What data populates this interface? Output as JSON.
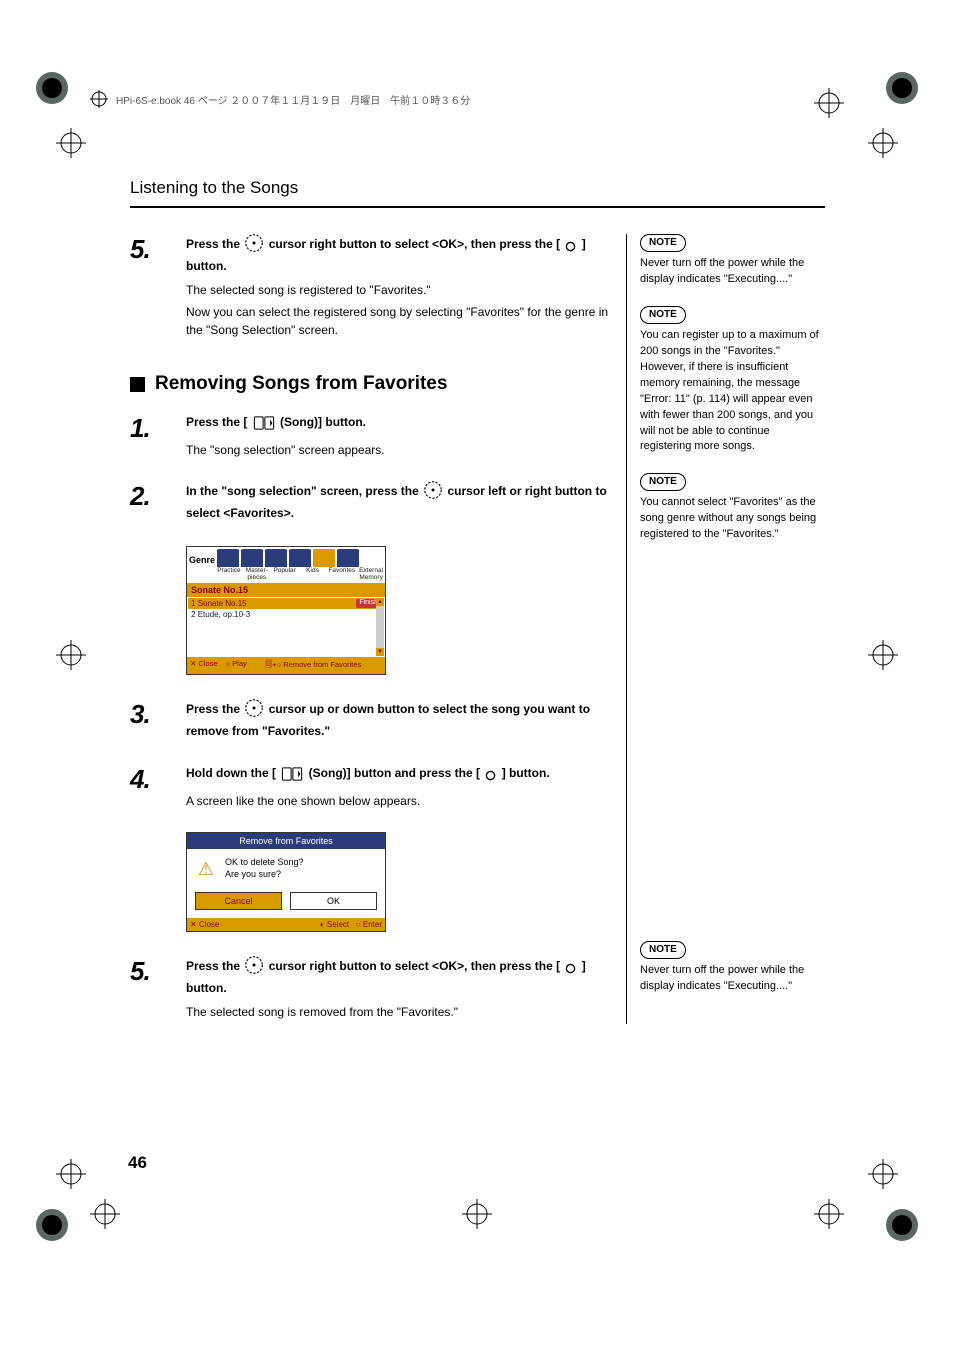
{
  "book_header": "HPi-6S-e.book  46 ページ  ２００７年１１月１９日　月曜日　午前１０時３６分",
  "page_title": "Listening to the Songs",
  "page_number": "46",
  "section1": {
    "step5": {
      "num": "5.",
      "head_a": "Press the ",
      "head_b": " cursor right button to select <OK>, then press the [",
      "head_c": "] button.",
      "desc1": "The selected song is registered to \"Favorites.\"",
      "desc2": "Now you can select the registered song by selecting \"Favorites\" for the genre in the \"Song Selection\" screen."
    }
  },
  "section2": {
    "heading": "Removing Songs from Favorites",
    "step1": {
      "num": "1.",
      "head_a": "Press the [",
      "head_b": " (Song)] button.",
      "desc1": "The \"song selection\" screen appears."
    },
    "step2": {
      "num": "2.",
      "head_a": "In the \"song selection\" screen, press the ",
      "head_b": " cursor left or right button to select <Favorites>."
    },
    "step3": {
      "num": "3.",
      "head_a": "Press the ",
      "head_b": " cursor up or down button to select the song you want to remove from \"Favorites.\""
    },
    "step4": {
      "num": "4.",
      "head_a": "Hold down the [",
      "head_b": " (Song)] button and press the [",
      "head_c": "] button.",
      "desc1": "A screen like the one shown below appears."
    },
    "step5": {
      "num": "5.",
      "head_a": "Press the ",
      "head_b": " cursor right button to select <OK>, then press the [",
      "head_c": "] button.",
      "desc1": "The selected song is removed from the \"Favorites.\""
    }
  },
  "screenshot1": {
    "genre_label": "Genre",
    "tabs": [
      "Practice",
      "Master-pieces",
      "Popular",
      "Kids",
      "Favorites",
      "External Memory"
    ],
    "title": "Sonate No.15",
    "rows": [
      {
        "idx": "1",
        "name": "Sonate No.15",
        "badge": "Finish"
      },
      {
        "idx": "2",
        "name": "Etude, op.10-3",
        "badge": ""
      }
    ],
    "footer": {
      "close": "✕ Close",
      "play": "○ Play",
      "remove": "🗐+○ Remove from Favorites"
    }
  },
  "dialog1": {
    "title": "Remove from Favorites",
    "msg1": "OK to delete Song?",
    "msg2": "Are you sure?",
    "cancel": "Cancel",
    "ok": "OK",
    "footer": {
      "close": "✕ Close",
      "select": "◐ Select",
      "enter": "○ Enter"
    }
  },
  "notes": {
    "n1": {
      "label": "NOTE",
      "text": "Never turn off the power while the display indicates \"Executing....\""
    },
    "n2": {
      "label": "NOTE",
      "text": "You can register up to a maximum of 200 songs in the \"Favorites.\" However, if there is insufficient memory remaining, the message \"Error: 11\" (p. 114) will appear even with fewer than 200 songs, and you will not be able to continue registering more songs."
    },
    "n3": {
      "label": "NOTE",
      "text": "You cannot select \"Favorites\" as the song genre without any songs being registered to the \"Favorites.\""
    },
    "n4": {
      "label": "NOTE",
      "text": "Never turn off the power while the display indicates \"Executing....\""
    }
  }
}
